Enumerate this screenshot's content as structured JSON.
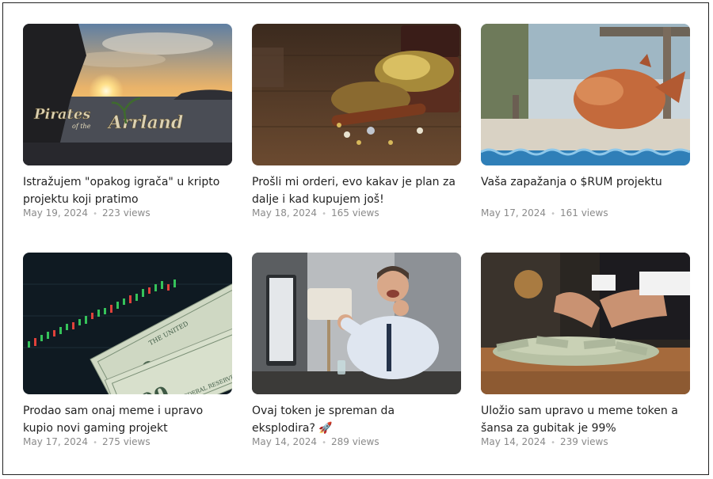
{
  "posts": [
    {
      "title": "Istražujem \"opakog igrača\" u kripto projektu koji pratimo",
      "date": "May 19, 2024",
      "views": "223 views",
      "image_text_1": "Pirates",
      "image_text_2": "of the",
      "image_text_3": "Arrland"
    },
    {
      "title": "Prošli mi orderi, evo kakav je plan za dalje i kad kupujem još!",
      "date": "May 18, 2024",
      "views": "165 views"
    },
    {
      "title": "Vaša zapažanja o $RUM projektu",
      "date": "May 17, 2024",
      "views": "161 views"
    },
    {
      "title": "Prodao sam onaj meme i upravo kupio novi gaming projekt",
      "date": "May 17, 2024",
      "views": "275 views",
      "image_text_1": "100",
      "image_text_2": "THE UNITED",
      "image_text_3": "FEDERAL RESERVE NOTE"
    },
    {
      "title": "Ovaj token je spreman da eksplodira? 🚀",
      "date": "May 14, 2024",
      "views": "289 views"
    },
    {
      "title": "Uložio sam upravo u meme token a šansa za gubitak je 99%",
      "date": "May 14, 2024",
      "views": "239 views"
    }
  ],
  "meta_separator": "•"
}
